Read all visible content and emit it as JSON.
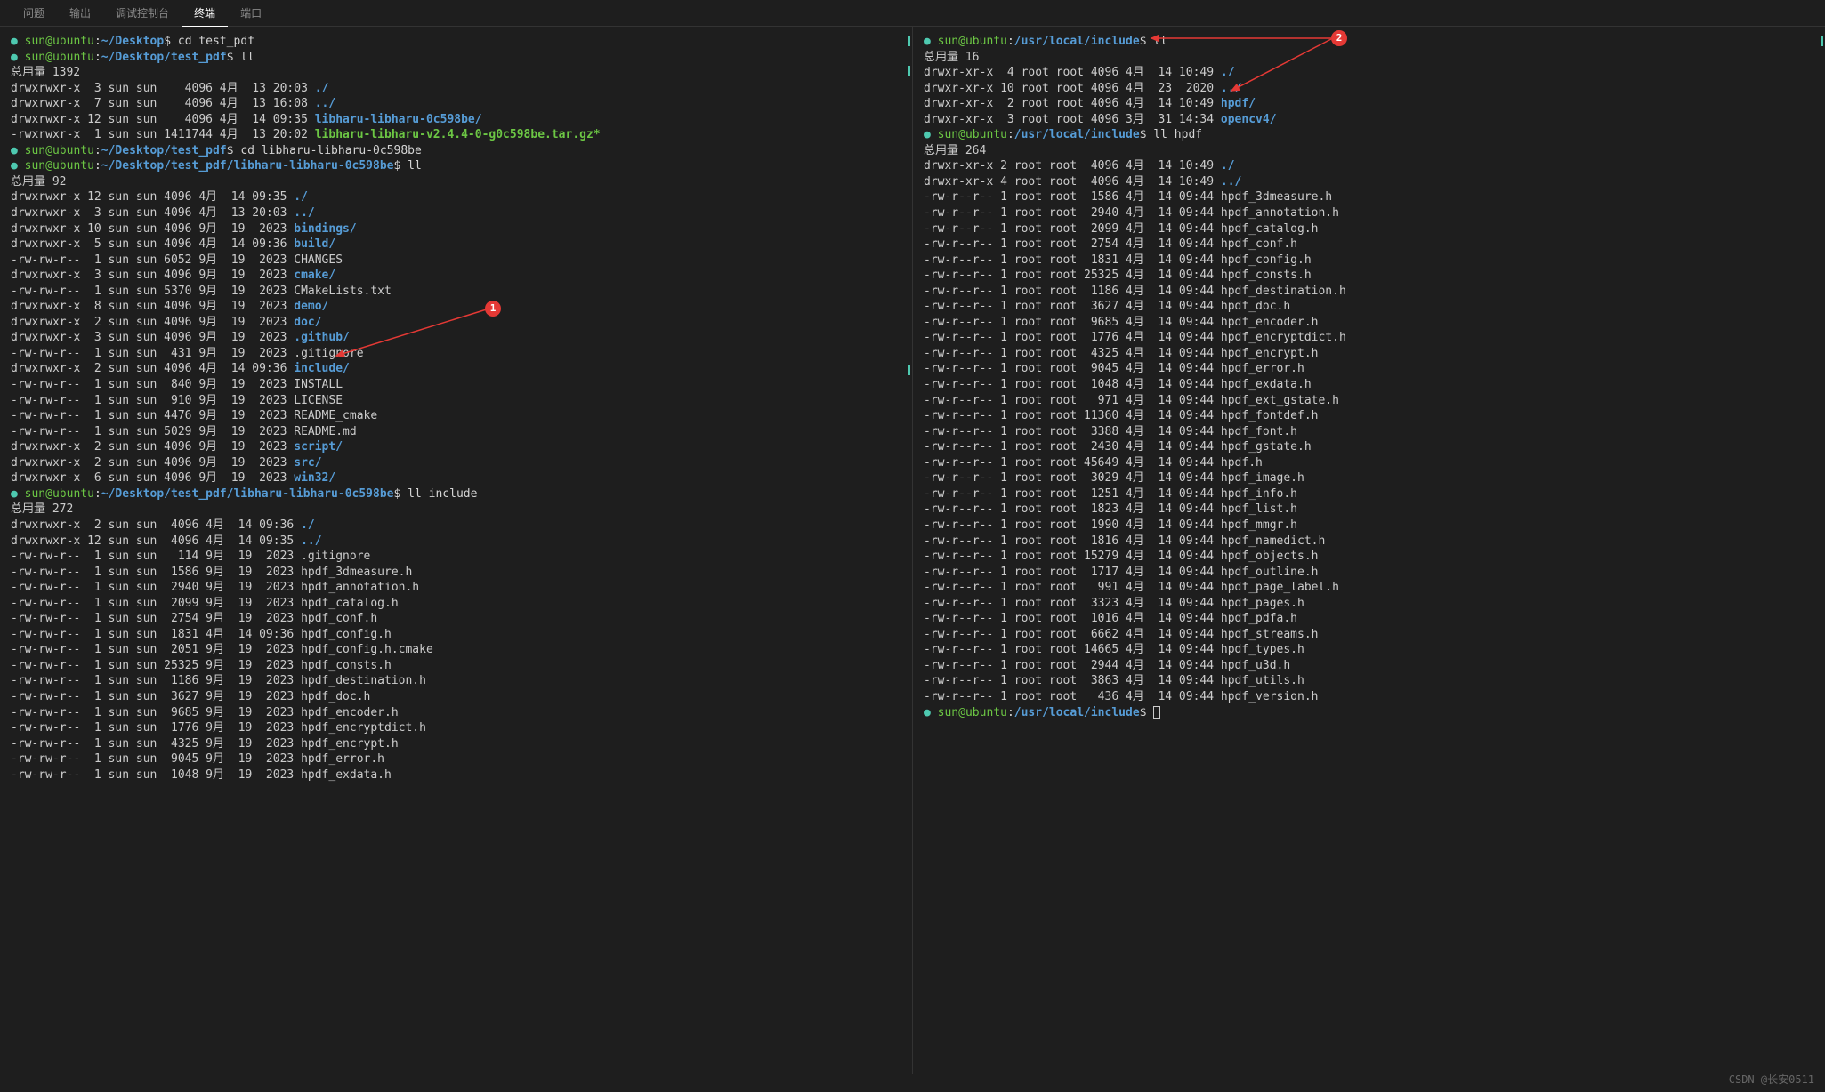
{
  "tabs": {
    "items": [
      "问题",
      "输出",
      "调试控制台",
      "终端",
      "端口"
    ],
    "active_index": 3
  },
  "left": {
    "prompt_user": "sun@ubuntu",
    "lines": [
      {
        "type": "prompt",
        "path": "~/Desktop",
        "cmd": "cd test_pdf"
      },
      {
        "type": "prompt",
        "path": "~/Desktop/test_pdf",
        "cmd": "ll"
      },
      {
        "type": "text",
        "content": "总用量 1392"
      },
      {
        "type": "ls",
        "perm": "drwxrwxr-x  3 sun sun    4096 4月  13 20:03 ",
        "name": "./",
        "cls": "dir"
      },
      {
        "type": "ls",
        "perm": "drwxrwxr-x  7 sun sun    4096 4月  13 16:08 ",
        "name": "../",
        "cls": "dir"
      },
      {
        "type": "ls",
        "perm": "drwxrwxr-x 12 sun sun    4096 4月  14 09:35 ",
        "name": "libharu-libharu-0c598be/",
        "cls": "dir"
      },
      {
        "type": "ls",
        "perm": "-rwxrwxr-x  1 sun sun 1411744 4月  13 20:02 ",
        "name": "libharu-libharu-v2.4.4-0-g0c598be.tar.gz*",
        "cls": "exec"
      },
      {
        "type": "prompt",
        "path": "~/Desktop/test_pdf",
        "cmd": "cd libharu-libharu-0c598be"
      },
      {
        "type": "prompt",
        "path": "~/Desktop/test_pdf/libharu-libharu-0c598be",
        "cmd": "ll"
      },
      {
        "type": "text",
        "content": "总用量 92"
      },
      {
        "type": "ls",
        "perm": "drwxrwxr-x 12 sun sun 4096 4月  14 09:35 ",
        "name": "./",
        "cls": "dir"
      },
      {
        "type": "ls",
        "perm": "drwxrwxr-x  3 sun sun 4096 4月  13 20:03 ",
        "name": "../",
        "cls": "dir"
      },
      {
        "type": "ls",
        "perm": "drwxrwxr-x 10 sun sun 4096 9月  19  2023 ",
        "name": "bindings/",
        "cls": "dir"
      },
      {
        "type": "ls",
        "perm": "drwxrwxr-x  5 sun sun 4096 4月  14 09:36 ",
        "name": "build/",
        "cls": "dir"
      },
      {
        "type": "ls",
        "perm": "-rw-rw-r--  1 sun sun 6052 9月  19  2023 ",
        "name": "CHANGES",
        "cls": ""
      },
      {
        "type": "ls",
        "perm": "drwxrwxr-x  3 sun sun 4096 9月  19  2023 ",
        "name": "cmake/",
        "cls": "dir"
      },
      {
        "type": "ls",
        "perm": "-rw-rw-r--  1 sun sun 5370 9月  19  2023 ",
        "name": "CMakeLists.txt",
        "cls": ""
      },
      {
        "type": "ls",
        "perm": "drwxrwxr-x  8 sun sun 4096 9月  19  2023 ",
        "name": "demo/",
        "cls": "dir"
      },
      {
        "type": "ls",
        "perm": "drwxrwxr-x  2 sun sun 4096 9月  19  2023 ",
        "name": "doc/",
        "cls": "dir"
      },
      {
        "type": "ls",
        "perm": "drwxrwxr-x  3 sun sun 4096 9月  19  2023 ",
        "name": ".github/",
        "cls": "dir"
      },
      {
        "type": "ls",
        "perm": "-rw-rw-r--  1 sun sun  431 9月  19  2023 ",
        "name": ".gitignore",
        "cls": ""
      },
      {
        "type": "ls",
        "perm": "drwxrwxr-x  2 sun sun 4096 4月  14 09:36 ",
        "name": "include/",
        "cls": "dir"
      },
      {
        "type": "ls",
        "perm": "-rw-rw-r--  1 sun sun  840 9月  19  2023 ",
        "name": "INSTALL",
        "cls": ""
      },
      {
        "type": "ls",
        "perm": "-rw-rw-r--  1 sun sun  910 9月  19  2023 ",
        "name": "LICENSE",
        "cls": ""
      },
      {
        "type": "ls",
        "perm": "-rw-rw-r--  1 sun sun 4476 9月  19  2023 ",
        "name": "README_cmake",
        "cls": ""
      },
      {
        "type": "ls",
        "perm": "-rw-rw-r--  1 sun sun 5029 9月  19  2023 ",
        "name": "README.md",
        "cls": ""
      },
      {
        "type": "ls",
        "perm": "drwxrwxr-x  2 sun sun 4096 9月  19  2023 ",
        "name": "script/",
        "cls": "dir"
      },
      {
        "type": "ls",
        "perm": "drwxrwxr-x  2 sun sun 4096 9月  19  2023 ",
        "name": "src/",
        "cls": "dir"
      },
      {
        "type": "ls",
        "perm": "drwxrwxr-x  6 sun sun 4096 9月  19  2023 ",
        "name": "win32/",
        "cls": "dir"
      },
      {
        "type": "prompt",
        "path": "~/Desktop/test_pdf/libharu-libharu-0c598be",
        "cmd": "ll include"
      },
      {
        "type": "text",
        "content": "总用量 272"
      },
      {
        "type": "ls",
        "perm": "drwxrwxr-x  2 sun sun  4096 4月  14 09:36 ",
        "name": "./",
        "cls": "dir"
      },
      {
        "type": "ls",
        "perm": "drwxrwxr-x 12 sun sun  4096 4月  14 09:35 ",
        "name": "../",
        "cls": "dir"
      },
      {
        "type": "ls",
        "perm": "-rw-rw-r--  1 sun sun   114 9月  19  2023 ",
        "name": ".gitignore",
        "cls": ""
      },
      {
        "type": "ls",
        "perm": "-rw-rw-r--  1 sun sun  1586 9月  19  2023 ",
        "name": "hpdf_3dmeasure.h",
        "cls": ""
      },
      {
        "type": "ls",
        "perm": "-rw-rw-r--  1 sun sun  2940 9月  19  2023 ",
        "name": "hpdf_annotation.h",
        "cls": ""
      },
      {
        "type": "ls",
        "perm": "-rw-rw-r--  1 sun sun  2099 9月  19  2023 ",
        "name": "hpdf_catalog.h",
        "cls": ""
      },
      {
        "type": "ls",
        "perm": "-rw-rw-r--  1 sun sun  2754 9月  19  2023 ",
        "name": "hpdf_conf.h",
        "cls": ""
      },
      {
        "type": "ls",
        "perm": "-rw-rw-r--  1 sun sun  1831 4月  14 09:36 ",
        "name": "hpdf_config.h",
        "cls": ""
      },
      {
        "type": "ls",
        "perm": "-rw-rw-r--  1 sun sun  2051 9月  19  2023 ",
        "name": "hpdf_config.h.cmake",
        "cls": ""
      },
      {
        "type": "ls",
        "perm": "-rw-rw-r--  1 sun sun 25325 9月  19  2023 ",
        "name": "hpdf_consts.h",
        "cls": ""
      },
      {
        "type": "ls",
        "perm": "-rw-rw-r--  1 sun sun  1186 9月  19  2023 ",
        "name": "hpdf_destination.h",
        "cls": ""
      },
      {
        "type": "ls",
        "perm": "-rw-rw-r--  1 sun sun  3627 9月  19  2023 ",
        "name": "hpdf_doc.h",
        "cls": ""
      },
      {
        "type": "ls",
        "perm": "-rw-rw-r--  1 sun sun  9685 9月  19  2023 ",
        "name": "hpdf_encoder.h",
        "cls": ""
      },
      {
        "type": "ls",
        "perm": "-rw-rw-r--  1 sun sun  1776 9月  19  2023 ",
        "name": "hpdf_encryptdict.h",
        "cls": ""
      },
      {
        "type": "ls",
        "perm": "-rw-rw-r--  1 sun sun  4325 9月  19  2023 ",
        "name": "hpdf_encrypt.h",
        "cls": ""
      },
      {
        "type": "ls",
        "perm": "-rw-rw-r--  1 sun sun  9045 9月  19  2023 ",
        "name": "hpdf_error.h",
        "cls": ""
      },
      {
        "type": "ls",
        "perm": "-rw-rw-r--  1 sun sun  1048 9月  19  2023 ",
        "name": "hpdf_exdata.h",
        "cls": ""
      }
    ]
  },
  "right": {
    "prompt_user": "sun@ubuntu",
    "lines": [
      {
        "type": "prompt",
        "path": "/usr/local/include",
        "cmd": "ll"
      },
      {
        "type": "text",
        "content": "总用量 16"
      },
      {
        "type": "ls",
        "perm": "drwxr-xr-x  4 root root 4096 4月  14 10:49 ",
        "name": "./",
        "cls": "dir"
      },
      {
        "type": "ls",
        "perm": "drwxr-xr-x 10 root root 4096 4月  23  2020 ",
        "name": "../",
        "cls": "dir"
      },
      {
        "type": "ls",
        "perm": "drwxr-xr-x  2 root root 4096 4月  14 10:49 ",
        "name": "hpdf/",
        "cls": "dir"
      },
      {
        "type": "ls",
        "perm": "drwxr-xr-x  3 root root 4096 3月  31 14:34 ",
        "name": "opencv4/",
        "cls": "dir"
      },
      {
        "type": "prompt",
        "path": "/usr/local/include",
        "cmd": "ll hpdf"
      },
      {
        "type": "text",
        "content": "总用量 264"
      },
      {
        "type": "ls",
        "perm": "drwxr-xr-x 2 root root  4096 4月  14 10:49 ",
        "name": "./",
        "cls": "dir"
      },
      {
        "type": "ls",
        "perm": "drwxr-xr-x 4 root root  4096 4月  14 10:49 ",
        "name": "../",
        "cls": "dir"
      },
      {
        "type": "ls",
        "perm": "-rw-r--r-- 1 root root  1586 4月  14 09:44 ",
        "name": "hpdf_3dmeasure.h",
        "cls": ""
      },
      {
        "type": "ls",
        "perm": "-rw-r--r-- 1 root root  2940 4月  14 09:44 ",
        "name": "hpdf_annotation.h",
        "cls": ""
      },
      {
        "type": "ls",
        "perm": "-rw-r--r-- 1 root root  2099 4月  14 09:44 ",
        "name": "hpdf_catalog.h",
        "cls": ""
      },
      {
        "type": "ls",
        "perm": "-rw-r--r-- 1 root root  2754 4月  14 09:44 ",
        "name": "hpdf_conf.h",
        "cls": ""
      },
      {
        "type": "ls",
        "perm": "-rw-r--r-- 1 root root  1831 4月  14 09:44 ",
        "name": "hpdf_config.h",
        "cls": ""
      },
      {
        "type": "ls",
        "perm": "-rw-r--r-- 1 root root 25325 4月  14 09:44 ",
        "name": "hpdf_consts.h",
        "cls": ""
      },
      {
        "type": "ls",
        "perm": "-rw-r--r-- 1 root root  1186 4月  14 09:44 ",
        "name": "hpdf_destination.h",
        "cls": ""
      },
      {
        "type": "ls",
        "perm": "-rw-r--r-- 1 root root  3627 4月  14 09:44 ",
        "name": "hpdf_doc.h",
        "cls": ""
      },
      {
        "type": "ls",
        "perm": "-rw-r--r-- 1 root root  9685 4月  14 09:44 ",
        "name": "hpdf_encoder.h",
        "cls": ""
      },
      {
        "type": "ls",
        "perm": "-rw-r--r-- 1 root root  1776 4月  14 09:44 ",
        "name": "hpdf_encryptdict.h",
        "cls": ""
      },
      {
        "type": "ls",
        "perm": "-rw-r--r-- 1 root root  4325 4月  14 09:44 ",
        "name": "hpdf_encrypt.h",
        "cls": ""
      },
      {
        "type": "ls",
        "perm": "-rw-r--r-- 1 root root  9045 4月  14 09:44 ",
        "name": "hpdf_error.h",
        "cls": ""
      },
      {
        "type": "ls",
        "perm": "-rw-r--r-- 1 root root  1048 4月  14 09:44 ",
        "name": "hpdf_exdata.h",
        "cls": ""
      },
      {
        "type": "ls",
        "perm": "-rw-r--r-- 1 root root   971 4月  14 09:44 ",
        "name": "hpdf_ext_gstate.h",
        "cls": ""
      },
      {
        "type": "ls",
        "perm": "-rw-r--r-- 1 root root 11360 4月  14 09:44 ",
        "name": "hpdf_fontdef.h",
        "cls": ""
      },
      {
        "type": "ls",
        "perm": "-rw-r--r-- 1 root root  3388 4月  14 09:44 ",
        "name": "hpdf_font.h",
        "cls": ""
      },
      {
        "type": "ls",
        "perm": "-rw-r--r-- 1 root root  2430 4月  14 09:44 ",
        "name": "hpdf_gstate.h",
        "cls": ""
      },
      {
        "type": "ls",
        "perm": "-rw-r--r-- 1 root root 45649 4月  14 09:44 ",
        "name": "hpdf.h",
        "cls": ""
      },
      {
        "type": "ls",
        "perm": "-rw-r--r-- 1 root root  3029 4月  14 09:44 ",
        "name": "hpdf_image.h",
        "cls": ""
      },
      {
        "type": "ls",
        "perm": "-rw-r--r-- 1 root root  1251 4月  14 09:44 ",
        "name": "hpdf_info.h",
        "cls": ""
      },
      {
        "type": "ls",
        "perm": "-rw-r--r-- 1 root root  1823 4月  14 09:44 ",
        "name": "hpdf_list.h",
        "cls": ""
      },
      {
        "type": "ls",
        "perm": "-rw-r--r-- 1 root root  1990 4月  14 09:44 ",
        "name": "hpdf_mmgr.h",
        "cls": ""
      },
      {
        "type": "ls",
        "perm": "-rw-r--r-- 1 root root  1816 4月  14 09:44 ",
        "name": "hpdf_namedict.h",
        "cls": ""
      },
      {
        "type": "ls",
        "perm": "-rw-r--r-- 1 root root 15279 4月  14 09:44 ",
        "name": "hpdf_objects.h",
        "cls": ""
      },
      {
        "type": "ls",
        "perm": "-rw-r--r-- 1 root root  1717 4月  14 09:44 ",
        "name": "hpdf_outline.h",
        "cls": ""
      },
      {
        "type": "ls",
        "perm": "-rw-r--r-- 1 root root   991 4月  14 09:44 ",
        "name": "hpdf_page_label.h",
        "cls": ""
      },
      {
        "type": "ls",
        "perm": "-rw-r--r-- 1 root root  3323 4月  14 09:44 ",
        "name": "hpdf_pages.h",
        "cls": ""
      },
      {
        "type": "ls",
        "perm": "-rw-r--r-- 1 root root  1016 4月  14 09:44 ",
        "name": "hpdf_pdfa.h",
        "cls": ""
      },
      {
        "type": "ls",
        "perm": "-rw-r--r-- 1 root root  6662 4月  14 09:44 ",
        "name": "hpdf_streams.h",
        "cls": ""
      },
      {
        "type": "ls",
        "perm": "-rw-r--r-- 1 root root 14665 4月  14 09:44 ",
        "name": "hpdf_types.h",
        "cls": ""
      },
      {
        "type": "ls",
        "perm": "-rw-r--r-- 1 root root  2944 4月  14 09:44 ",
        "name": "hpdf_u3d.h",
        "cls": ""
      },
      {
        "type": "ls",
        "perm": "-rw-r--r-- 1 root root  3863 4月  14 09:44 ",
        "name": "hpdf_utils.h",
        "cls": ""
      },
      {
        "type": "ls",
        "perm": "-rw-r--r-- 1 root root   436 4月  14 09:44 ",
        "name": "hpdf_version.h",
        "cls": ""
      },
      {
        "type": "prompt",
        "path": "/usr/local/include",
        "cmd": "",
        "cursor": true
      }
    ]
  },
  "markers": {
    "m1": "1",
    "m2": "2"
  },
  "watermark": "CSDN @长安0511"
}
